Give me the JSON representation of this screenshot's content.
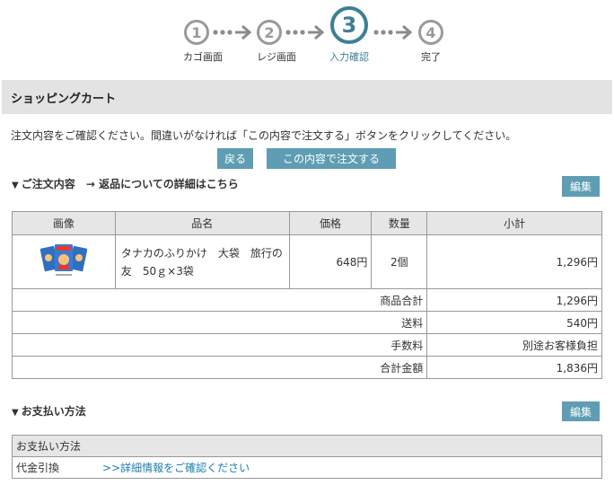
{
  "steps": [
    {
      "number": "1",
      "label": "カゴ画面",
      "active": false
    },
    {
      "number": "2",
      "label": "レジ画面",
      "active": false
    },
    {
      "number": "3",
      "label": "入力確認",
      "active": true
    },
    {
      "number": "4",
      "label": "完了",
      "active": false
    }
  ],
  "header": {
    "title": "ショッピングカート"
  },
  "instruction": "注文内容をご確認ください。間違いがなければ「この内容で注文する」ボタンをクリックしてください。",
  "buttons": {
    "back": "戻る",
    "confirm": "この内容で注文する",
    "edit": "編集"
  },
  "order": {
    "title": "ご注文内容",
    "return_link": "→ 返品についての詳細はこちら",
    "columns": [
      "画像",
      "品名",
      "価格",
      "数量",
      "小計"
    ],
    "item": {
      "name": "タナカのふりかけ　大袋　旅行の友　50ｇ×3袋",
      "price": "648円",
      "quantity": "2個",
      "subtotal": "1,296円"
    },
    "summary": [
      {
        "label": "商品合計",
        "value": "1,296円"
      },
      {
        "label": "送料",
        "value": "540円"
      },
      {
        "label": "手数料",
        "value": "別途お客様負担"
      },
      {
        "label": "合計金額",
        "value": "1,836円"
      }
    ]
  },
  "payment": {
    "title": "お支払い方法",
    "table_header": "お支払い方法",
    "method": "代金引換",
    "detail_link": ">>詳細情報をご確認ください"
  },
  "colors": {
    "accent": "#3e7f96",
    "button": "#5e9db3",
    "link": "#1e7fb0",
    "header_bg": "#e3e3e3"
  }
}
